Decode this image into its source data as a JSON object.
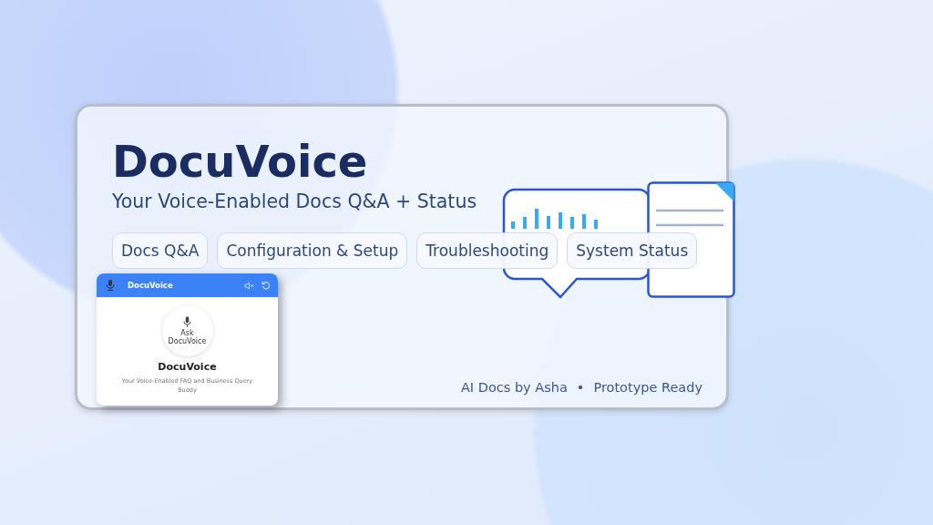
{
  "hero": {
    "title": "DocuVoice",
    "subtitle": "Your Voice-Enabled Docs Q&A + Status",
    "tags": [
      "Docs Q&A",
      "Configuration & Setup",
      "Troubleshooting",
      "System Status"
    ],
    "footer": {
      "byline": "AI Docs by Asha",
      "separator": "•",
      "status": "Prototype Ready"
    }
  },
  "preview": {
    "app_title": "DocuVoice",
    "badge_label": "Ask DocuVoice",
    "heading": "DocuVoice",
    "description": "Your Voice-Enabled FAQ and Business Query Buddy"
  }
}
